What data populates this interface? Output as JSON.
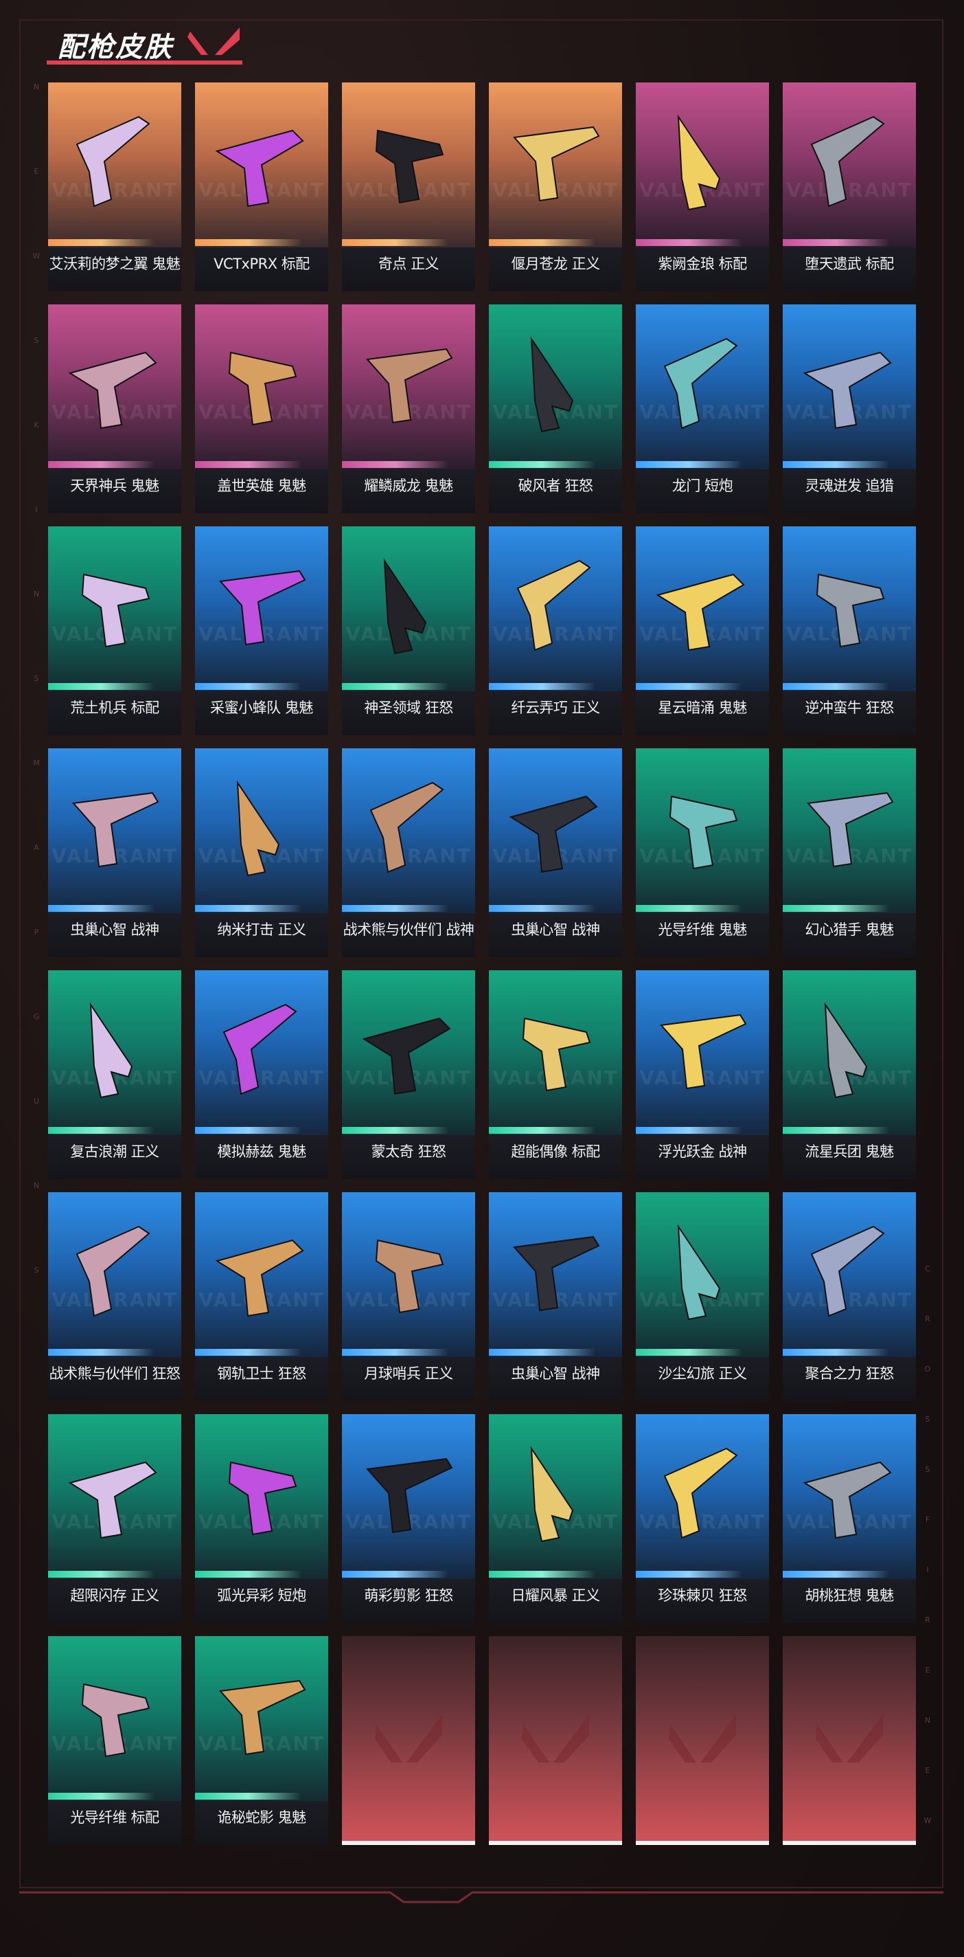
{
  "header": {
    "title": "配枪皮肤"
  },
  "brand": {
    "watermark": "VALORANT"
  },
  "side_letters_left": [
    "N",
    "E",
    "W",
    "S",
    "K",
    "I",
    "N",
    "S",
    "M",
    "A",
    "P",
    "G",
    "U",
    "N",
    "S"
  ],
  "side_letters_right": [
    "C",
    "R",
    "O",
    "S",
    "S",
    "F",
    "I",
    "R",
    "E",
    "N",
    "E",
    "W"
  ],
  "colors": {
    "orange": "#ef9a5f",
    "pink": "#c3528f",
    "teal": "#17a880",
    "blue": "#2f8ee6",
    "accent_red": "#e0404f",
    "empty_red": "#d2545a"
  },
  "skins": [
    {
      "label": "艾沃莉的梦之翼 鬼魅",
      "rarity": "orange"
    },
    {
      "label": "VCTxPRX 标配",
      "rarity": "orange"
    },
    {
      "label": "奇点 正义",
      "rarity": "orange"
    },
    {
      "label": "偃月苍龙 正义",
      "rarity": "orange"
    },
    {
      "label": "紫阙金琅 标配",
      "rarity": "pink"
    },
    {
      "label": "堕天遗武 标配",
      "rarity": "pink"
    },
    {
      "label": "天界神兵 鬼魅",
      "rarity": "pink"
    },
    {
      "label": "盖世英雄 鬼魅",
      "rarity": "pink"
    },
    {
      "label": "耀鳞威龙 鬼魅",
      "rarity": "pink"
    },
    {
      "label": "破风者 狂怒",
      "rarity": "teal"
    },
    {
      "label": "龙门 短炮",
      "rarity": "blue"
    },
    {
      "label": "灵魂迸发 追猎",
      "rarity": "blue"
    },
    {
      "label": "荒土机兵 标配",
      "rarity": "teal"
    },
    {
      "label": "采蜜小蜂队 鬼魅",
      "rarity": "blue"
    },
    {
      "label": "神圣领域 狂怒",
      "rarity": "teal"
    },
    {
      "label": "纤云弄巧 正义",
      "rarity": "blue"
    },
    {
      "label": "星云暗涌 鬼魅",
      "rarity": "blue"
    },
    {
      "label": "逆冲蛮牛 狂怒",
      "rarity": "blue"
    },
    {
      "label": "虫巢心智 战神",
      "rarity": "blue"
    },
    {
      "label": "纳米打击 正义",
      "rarity": "blue"
    },
    {
      "label": "战术熊与伙伴们 战神",
      "rarity": "blue"
    },
    {
      "label": "虫巢心智 战神",
      "rarity": "blue"
    },
    {
      "label": "光导纤维 鬼魅",
      "rarity": "teal"
    },
    {
      "label": "幻心猎手 鬼魅",
      "rarity": "teal"
    },
    {
      "label": "复古浪潮 正义",
      "rarity": "teal"
    },
    {
      "label": "模拟赫兹 鬼魅",
      "rarity": "blue"
    },
    {
      "label": "蒙太奇 狂怒",
      "rarity": "teal"
    },
    {
      "label": "超能偶像 标配",
      "rarity": "teal"
    },
    {
      "label": "浮光跃金 战神",
      "rarity": "blue"
    },
    {
      "label": "流星兵团 鬼魅",
      "rarity": "teal"
    },
    {
      "label": "战术熊与伙伴们 狂怒",
      "rarity": "blue"
    },
    {
      "label": "钢轨卫士 狂怒",
      "rarity": "blue"
    },
    {
      "label": "月球哨兵 正义",
      "rarity": "blue"
    },
    {
      "label": "虫巢心智 战神",
      "rarity": "blue"
    },
    {
      "label": "沙尘幻旅 正义",
      "rarity": "teal"
    },
    {
      "label": "聚合之力 狂怒",
      "rarity": "blue"
    },
    {
      "label": "超限闪存 正义",
      "rarity": "teal"
    },
    {
      "label": "弧光异彩 短炮",
      "rarity": "teal"
    },
    {
      "label": "萌彩剪影 狂怒",
      "rarity": "blue"
    },
    {
      "label": "日耀风暴 正义",
      "rarity": "teal"
    },
    {
      "label": "珍珠棘贝 狂怒",
      "rarity": "blue"
    },
    {
      "label": "胡桃狂想 鬼魅",
      "rarity": "blue"
    },
    {
      "label": "光导纤维 标配",
      "rarity": "teal"
    },
    {
      "label": "诡秘蛇影 鬼魅",
      "rarity": "teal"
    }
  ],
  "empty_slots": 4
}
